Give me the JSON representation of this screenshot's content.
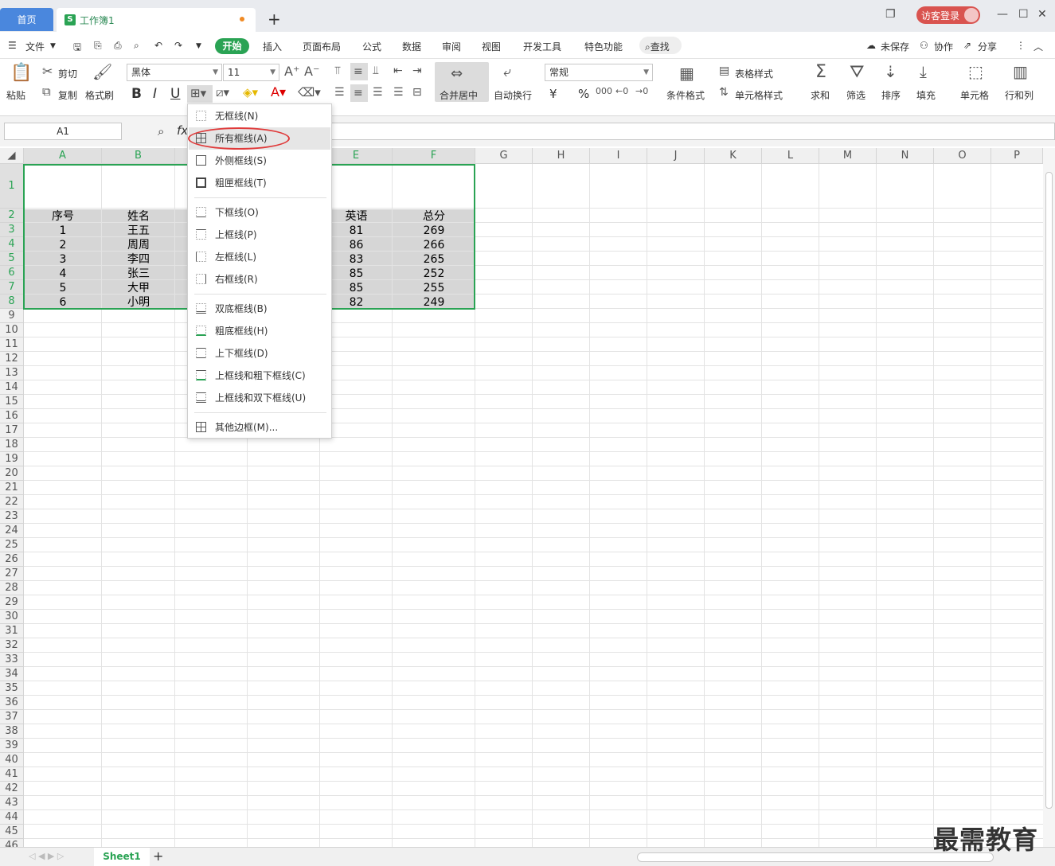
{
  "titlebar": {
    "home_tab": "首页",
    "doc_tab": "工作簿1",
    "doc_icon": "S",
    "new_tab": "+",
    "login": "访客登录"
  },
  "menubar": {
    "file": "文件",
    "items": [
      "开始",
      "插入",
      "页面布局",
      "公式",
      "数据",
      "审阅",
      "视图",
      "开发工具",
      "特色功能"
    ],
    "search": "查找",
    "unsaved": "未保存",
    "collab": "协作",
    "share": "分享"
  },
  "ribbon": {
    "paste": "粘贴",
    "cut": "剪切",
    "copy": "复制",
    "format_painter": "格式刷",
    "font_name": "黑体",
    "font_size": "11",
    "bold": "B",
    "italic": "I",
    "underline": "U",
    "merge_center": "合并居中",
    "wrap": "自动换行",
    "number_format": "常规",
    "currency": "¥",
    "percent": "%",
    "cond_format": "条件格式",
    "table_style": "表格样式",
    "cell_style": "单元格样式",
    "sum": "求和",
    "filter": "筛选",
    "sort": "排序",
    "fill": "填充",
    "cell": "单元格",
    "rowcol": "行和列"
  },
  "formula": {
    "name_box": "A1",
    "fx": "fx"
  },
  "columns": [
    "A",
    "B",
    "C",
    "D",
    "E",
    "F",
    "G",
    "H",
    "I",
    "J",
    "K",
    "L",
    "M",
    "N",
    "O",
    "P"
  ],
  "rows": [
    "1",
    "2",
    "3",
    "4",
    "5",
    "6",
    "7",
    "8",
    "9",
    "10",
    "11",
    "12",
    "13",
    "14",
    "15",
    "16",
    "17",
    "18",
    "19",
    "20",
    "21",
    "22",
    "23",
    "24",
    "25",
    "26",
    "27",
    "28",
    "29",
    "30",
    "31",
    "32",
    "33",
    "34",
    "35",
    "36",
    "37",
    "38",
    "39",
    "40",
    "41",
    "42",
    "43",
    "44",
    "45",
    "46"
  ],
  "table": {
    "headers": {
      "a": "序号",
      "b": "姓名",
      "e": "英语",
      "f": "总分"
    },
    "rows": [
      {
        "a": "1",
        "b": "王五",
        "e": "81",
        "f": "269"
      },
      {
        "a": "2",
        "b": "周周",
        "e": "86",
        "f": "266"
      },
      {
        "a": "3",
        "b": "李四",
        "e": "83",
        "f": "265"
      },
      {
        "a": "4",
        "b": "张三",
        "e": "85",
        "f": "252"
      },
      {
        "a": "5",
        "b": "大甲",
        "e": "85",
        "f": "255"
      },
      {
        "a": "6",
        "b": "小明",
        "e": "82",
        "f": "249"
      }
    ]
  },
  "border_menu": {
    "items": [
      "无框线(N)",
      "所有框线(A)",
      "外侧框线(S)",
      "粗匣框线(T)",
      "下框线(O)",
      "上框线(P)",
      "左框线(L)",
      "右框线(R)",
      "双底框线(B)",
      "粗底框线(H)",
      "上下框线(D)",
      "上框线和粗下框线(C)",
      "上框线和双下框线(U)",
      "其他边框(M)..."
    ]
  },
  "sheetbar": {
    "sheet1": "Sheet1",
    "add": "+"
  },
  "watermark": "最需教育",
  "colors": {
    "accent": "#2aa354",
    "home_tab": "#4a87dd",
    "highlight_circle": "#e03a3a"
  }
}
